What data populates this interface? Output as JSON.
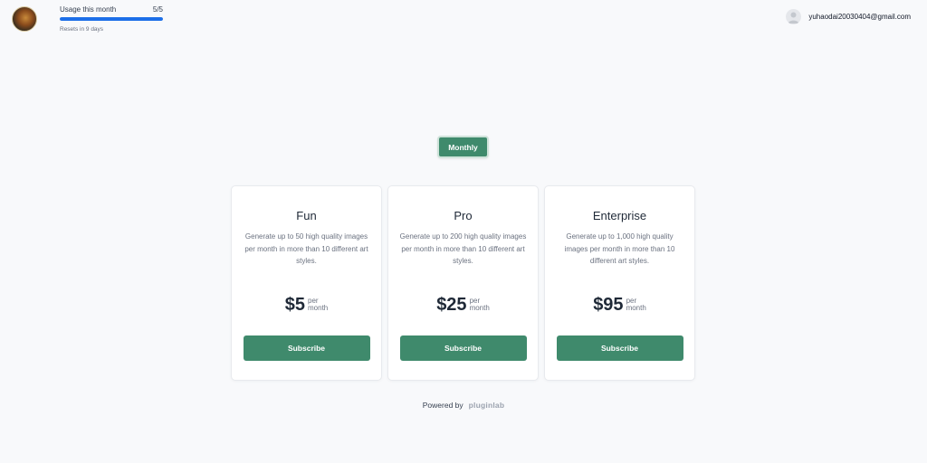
{
  "header": {
    "usage": {
      "label": "Usage this month",
      "count": "5/5",
      "progress_fraction": 1.0,
      "reset_text": "Resets in 9 days",
      "bar_color": "#1d6fe8"
    },
    "account": {
      "email": "yuhaodai20030404@gmail.com",
      "icon": "user-icon"
    }
  },
  "billing_toggle": {
    "label": "Monthly"
  },
  "plans": [
    {
      "name": "Fun",
      "description": "Generate up to 50 high quality images per month in more than 10 different art styles.",
      "price": "$5",
      "per": "per",
      "period": "month",
      "button": "Subscribe"
    },
    {
      "name": "Pro",
      "description": "Generate up to 200 high quality images per month in more than 10 different art styles.",
      "price": "$25",
      "per": "per",
      "period": "month",
      "button": "Subscribe"
    },
    {
      "name": "Enterprise",
      "description": "Generate up to 1,000 high quality images per month in more than 10 different art styles.",
      "price": "$95",
      "per": "per",
      "period": "month",
      "button": "Subscribe"
    }
  ],
  "footer": {
    "powered_by": "Powered by",
    "brand": "pluginlab"
  },
  "colors": {
    "accent": "#3f8a6c",
    "background": "#f8f9fb"
  }
}
